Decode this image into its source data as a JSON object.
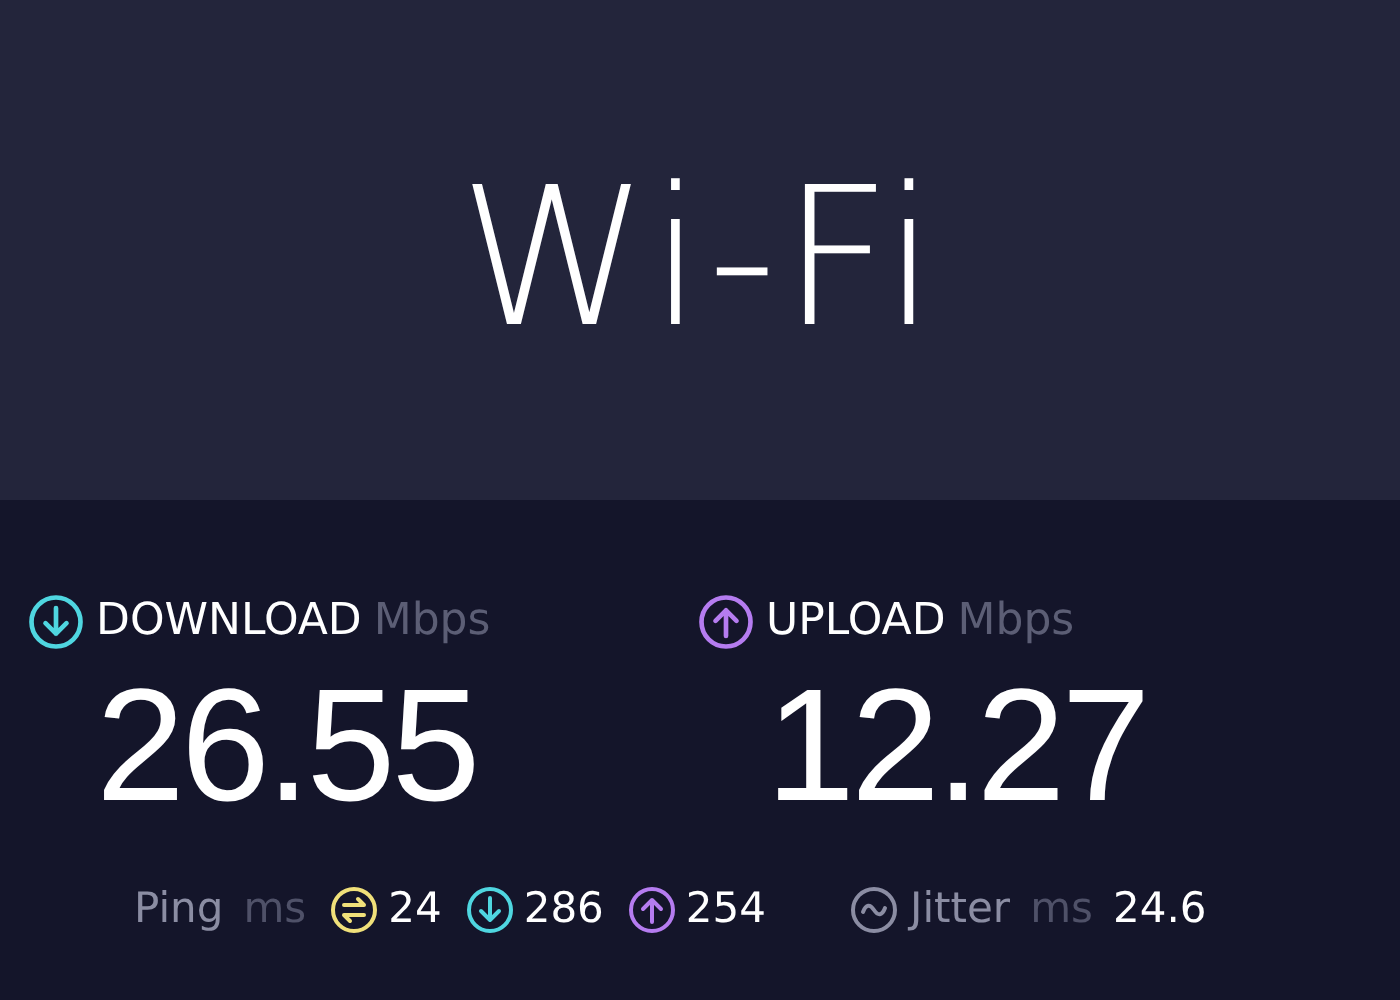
{
  "connection": {
    "title": "Wi-Fi"
  },
  "metrics": [
    {
      "kind": "download",
      "label": "DOWNLOAD",
      "unit": "Mbps",
      "value": "26.55",
      "color": "#4fd6e0"
    },
    {
      "kind": "upload",
      "label": "UPLOAD",
      "unit": "Mbps",
      "value": "12.27",
      "color": "#b57cf0"
    }
  ],
  "ping": {
    "label": "Ping",
    "unit": "ms",
    "readings": [
      {
        "kind": "idle",
        "value": "24",
        "color": "#f0e07a"
      },
      {
        "kind": "download",
        "value": "286",
        "color": "#4fd6e0"
      },
      {
        "kind": "upload",
        "value": "254",
        "color": "#b57cf0"
      }
    ]
  },
  "jitter": {
    "label": "Jitter",
    "unit": "ms",
    "value": "24.6"
  }
}
